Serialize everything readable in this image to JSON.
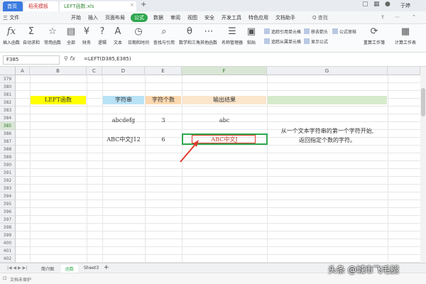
{
  "titlebar": {
    "tab_home": "首页",
    "tab_wps": "稻壳模板",
    "tab_doc": "LEFT函数.xls",
    "user": "于婷"
  },
  "menu": {
    "file": "三 文件",
    "items": [
      "开始",
      "插入",
      "页面布局",
      "公式",
      "数据",
      "审阅",
      "视图",
      "安全",
      "开发工具",
      "特色应用",
      "文档助手"
    ],
    "active": "公式",
    "search": "Q 查找"
  },
  "ribbon": {
    "buttons": [
      "插入函数",
      "自动求和",
      "常用函数",
      "全部",
      "财务",
      "逻辑",
      "文本",
      "日期和时间",
      "查找与引用",
      "数学和三角",
      "其他函数",
      "名称管理器",
      "粘贴",
      "计算工作表"
    ],
    "small": [
      "追踪引用单元格",
      "移去箭头",
      "公式审核",
      "追踪从属单元格",
      "显示公式",
      "重算工作簿"
    ]
  },
  "formula_bar": {
    "name_box": "F385",
    "formula": "=LEFT(D385,E385)"
  },
  "columns": [
    "A",
    "B",
    "C",
    "D",
    "E",
    "F",
    "G"
  ],
  "rows": [
    "379",
    "380",
    "381",
    "382",
    "383",
    "384",
    "385",
    "386",
    "387",
    "388",
    "389",
    "390",
    "391",
    "392",
    "393",
    "394",
    "395",
    "396",
    "397",
    "398",
    "399",
    "400",
    "401",
    "402"
  ],
  "cells": {
    "b381": "LEFT函数",
    "d381": "字符串",
    "e381": "字符个数",
    "f381": "输出结果",
    "d383": "abcdefg",
    "e383": "3",
    "f383": "abc",
    "d385": "ABC中文J12",
    "e385": "6",
    "f385": "ABC中文J"
  },
  "note": {
    "line1": "从一个文本字符串的第一个字符开始,",
    "line2": "返回指定个数的字符。"
  },
  "sheets": [
    "简介图",
    "函数",
    "Sheet3"
  ],
  "active_sheet": "函数",
  "status": "文档未保护",
  "watermark": "头条 @城市飞毛腿",
  "colors": {
    "accent": "#2fa84f",
    "highlight_red": "#e03b2c"
  }
}
